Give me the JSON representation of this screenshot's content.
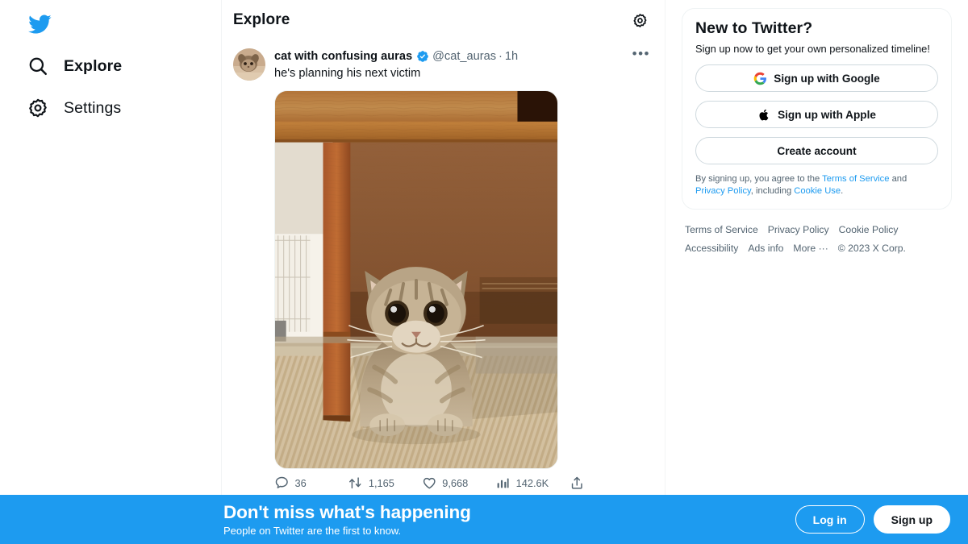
{
  "colors": {
    "accent": "#1d9bf0",
    "text_primary": "#0f1419",
    "text_secondary": "#536471",
    "border": "#eff3f4",
    "banner_bg": "#1d9bf0",
    "verified_blue": "#1d9bf0"
  },
  "sidebar": {
    "logo_icon": "twitter-bird-icon",
    "items": [
      {
        "label": "Explore",
        "icon": "search-icon",
        "active": true
      },
      {
        "label": "Settings",
        "icon": "gear-icon",
        "active": false
      }
    ]
  },
  "center": {
    "header": {
      "title": "Explore",
      "settings_icon": "gear-icon"
    },
    "tweet": {
      "avatar_icon": "avatar",
      "display_name": "cat with confusing auras",
      "verified_icon": "verified-badge-icon",
      "handle": "@cat_auras",
      "separator": "·",
      "timestamp": "1h",
      "more_icon": "more-options-icon",
      "more_glyph": "•••",
      "text": "he's planning his next victim",
      "media_alt": "cat under wooden table on tatami mat",
      "actions": [
        {
          "name": "reply",
          "icon": "reply-icon",
          "count": "36"
        },
        {
          "name": "retweet",
          "icon": "retweet-icon",
          "count": "1,165"
        },
        {
          "name": "like",
          "icon": "heart-icon",
          "count": "9,668"
        },
        {
          "name": "views",
          "icon": "analytics-icon",
          "count": "142.6K"
        },
        {
          "name": "share",
          "icon": "share-icon",
          "count": ""
        }
      ]
    }
  },
  "right": {
    "signup": {
      "title": "New to Twitter?",
      "subtitle": "Sign up now to get your own personalized timeline!",
      "buttons": [
        {
          "label": "Sign up with Google",
          "icon": "google-icon"
        },
        {
          "label": "Sign up with Apple",
          "icon": "apple-icon"
        },
        {
          "label": "Create account",
          "icon": ""
        }
      ],
      "legal": {
        "lead": "By signing up, you agree to the ",
        "terms": "Terms of Service",
        "and": " and ",
        "privacy": "Privacy Policy",
        "including": ", including ",
        "cookie": "Cookie Use",
        "period": "."
      }
    },
    "footer_links": [
      "Terms of Service",
      "Privacy Policy",
      "Cookie Policy",
      "Accessibility",
      "Ads info",
      "More ···"
    ],
    "copyright": "© 2023 X Corp."
  },
  "banner": {
    "heading": "Don't miss what's happening",
    "subheading": "People on Twitter are the first to know.",
    "login_label": "Log in",
    "signup_label": "Sign up"
  }
}
